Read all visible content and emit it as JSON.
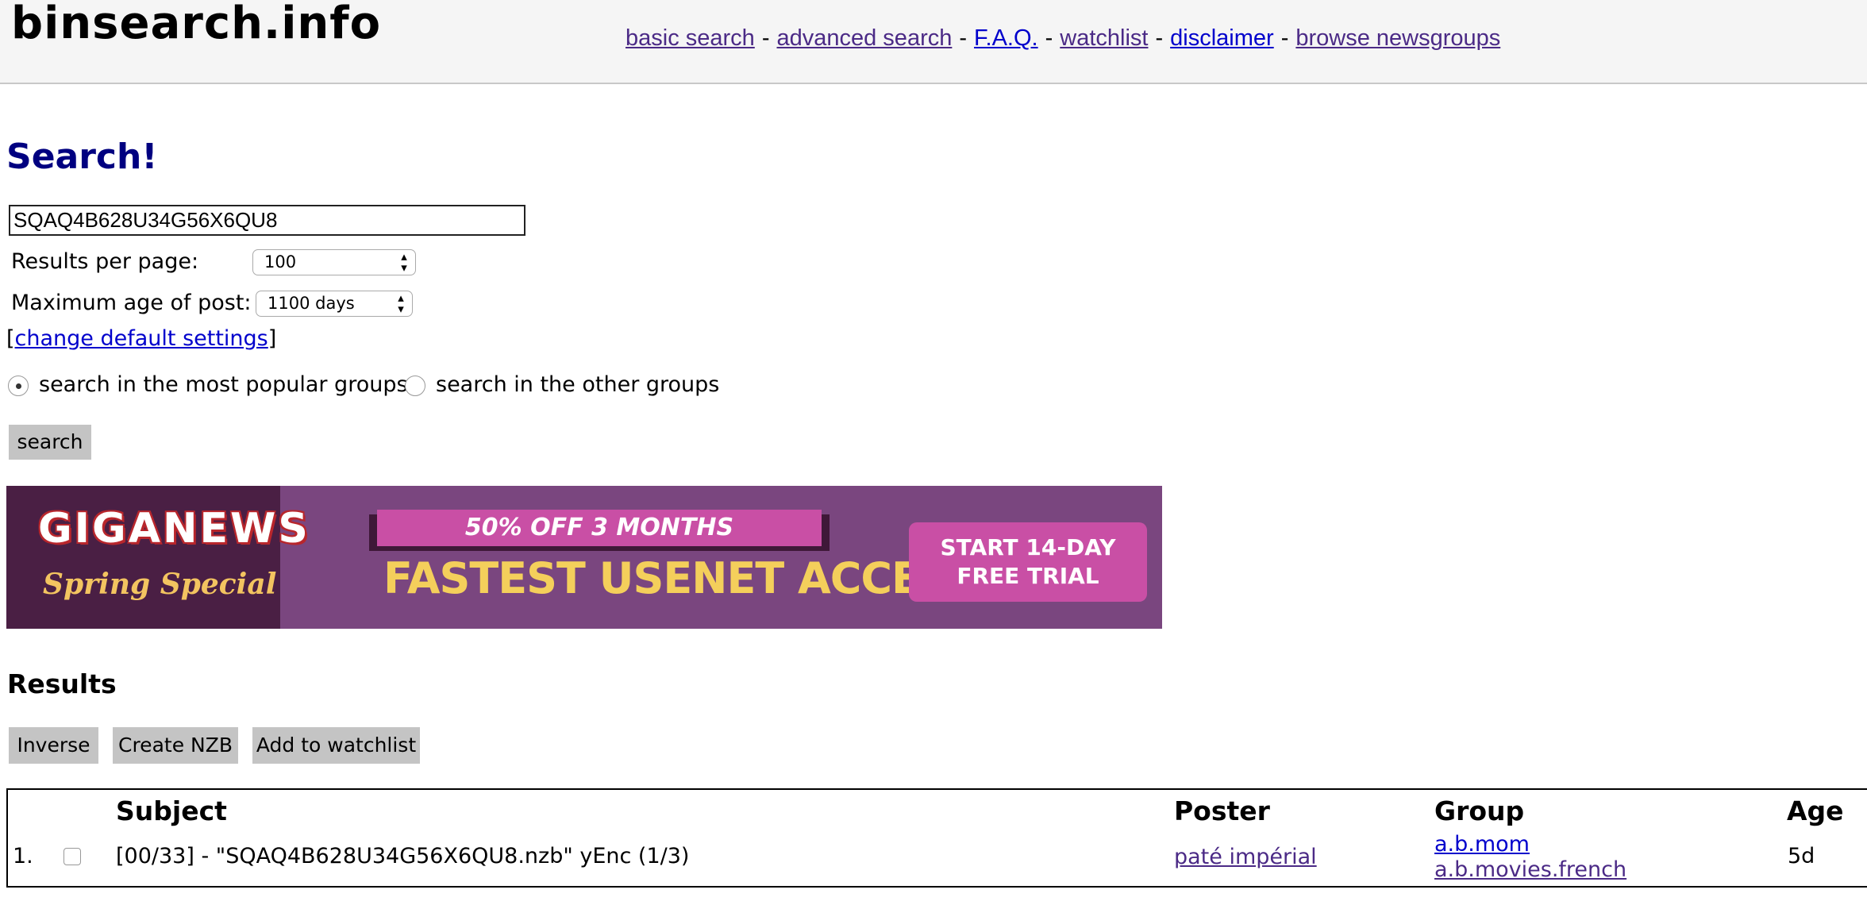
{
  "header": {
    "logo": "binsearch.info",
    "nav": {
      "basic_search": "basic search",
      "advanced_search": "advanced search",
      "faq": "F.A.Q.",
      "watchlist": "watchlist",
      "disclaimer": "disclaimer",
      "browse_newsgroups": "browse newsgroups",
      "separator": "-"
    }
  },
  "search": {
    "title": "Search!",
    "query_value": "SQAQ4B628U34G56X6QU8",
    "results_per_page_label": "Results per page:",
    "results_per_page_value": "100",
    "max_age_label": "Maximum age of post:",
    "max_age_value": "1100 days",
    "change_settings_link": "change default settings",
    "bracket_open": "[",
    "bracket_close": "]",
    "radio_popular_label": "search in the most popular groups",
    "radio_other_label": "search in the other groups",
    "radio_selected": "popular",
    "search_button": "search"
  },
  "banner": {
    "brand": "GIGANEWS",
    "tagline": "Spring Special",
    "offer": "50% OFF 3 MONTHS",
    "headline": "FASTEST USENET ACCESS",
    "cta_line1": "START 14-DAY",
    "cta_line2": "FREE TRIAL"
  },
  "results": {
    "title": "Results",
    "buttons": {
      "inverse": "Inverse",
      "create_nzb": "Create NZB",
      "add_watchlist": "Add to watchlist"
    },
    "columns": {
      "subject": "Subject",
      "poster": "Poster",
      "group": "Group",
      "age": "Age"
    },
    "rows": [
      {
        "index": "1.",
        "subject": "[00/33] - \"SQAQ4B628U34G56X6QU8.nzb\" yEnc (1/3)",
        "poster": "paté impérial",
        "groups": [
          "a.b.mom",
          "a.b.movies.french"
        ],
        "age": "5d"
      }
    ]
  },
  "colors": {
    "title_blue": "#000080",
    "link_visited": "#4b2a86",
    "link_blue": "#0000cc",
    "button_gray": "#c4c4c4",
    "banner_purple": "#7a467f"
  }
}
